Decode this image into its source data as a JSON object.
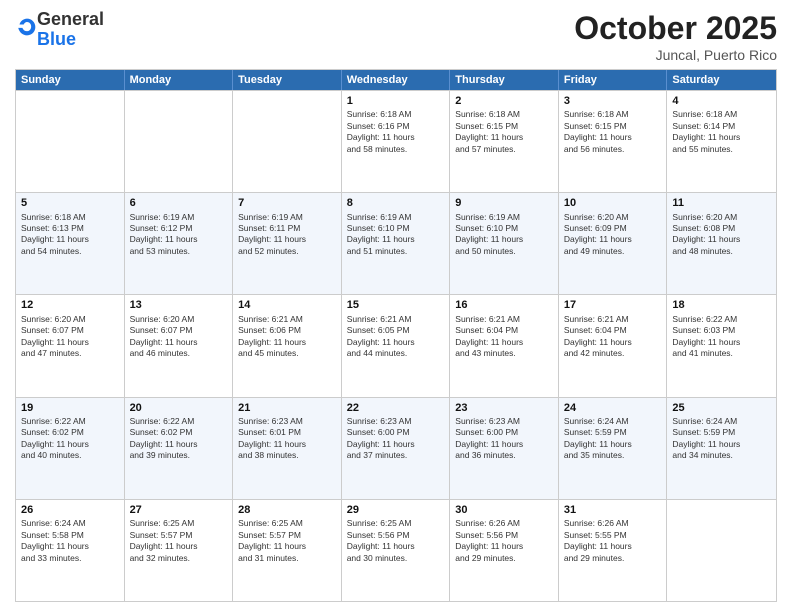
{
  "logo": {
    "general": "General",
    "blue": "Blue"
  },
  "title": {
    "month": "October 2025",
    "location": "Juncal, Puerto Rico"
  },
  "header_days": [
    "Sunday",
    "Monday",
    "Tuesday",
    "Wednesday",
    "Thursday",
    "Friday",
    "Saturday"
  ],
  "rows": [
    {
      "alt": false,
      "cells": [
        {
          "day": "",
          "info": ""
        },
        {
          "day": "",
          "info": ""
        },
        {
          "day": "",
          "info": ""
        },
        {
          "day": "1",
          "info": "Sunrise: 6:18 AM\nSunset: 6:16 PM\nDaylight: 11 hours\nand 58 minutes."
        },
        {
          "day": "2",
          "info": "Sunrise: 6:18 AM\nSunset: 6:15 PM\nDaylight: 11 hours\nand 57 minutes."
        },
        {
          "day": "3",
          "info": "Sunrise: 6:18 AM\nSunset: 6:15 PM\nDaylight: 11 hours\nand 56 minutes."
        },
        {
          "day": "4",
          "info": "Sunrise: 6:18 AM\nSunset: 6:14 PM\nDaylight: 11 hours\nand 55 minutes."
        }
      ]
    },
    {
      "alt": true,
      "cells": [
        {
          "day": "5",
          "info": "Sunrise: 6:18 AM\nSunset: 6:13 PM\nDaylight: 11 hours\nand 54 minutes."
        },
        {
          "day": "6",
          "info": "Sunrise: 6:19 AM\nSunset: 6:12 PM\nDaylight: 11 hours\nand 53 minutes."
        },
        {
          "day": "7",
          "info": "Sunrise: 6:19 AM\nSunset: 6:11 PM\nDaylight: 11 hours\nand 52 minutes."
        },
        {
          "day": "8",
          "info": "Sunrise: 6:19 AM\nSunset: 6:10 PM\nDaylight: 11 hours\nand 51 minutes."
        },
        {
          "day": "9",
          "info": "Sunrise: 6:19 AM\nSunset: 6:10 PM\nDaylight: 11 hours\nand 50 minutes."
        },
        {
          "day": "10",
          "info": "Sunrise: 6:20 AM\nSunset: 6:09 PM\nDaylight: 11 hours\nand 49 minutes."
        },
        {
          "day": "11",
          "info": "Sunrise: 6:20 AM\nSunset: 6:08 PM\nDaylight: 11 hours\nand 48 minutes."
        }
      ]
    },
    {
      "alt": false,
      "cells": [
        {
          "day": "12",
          "info": "Sunrise: 6:20 AM\nSunset: 6:07 PM\nDaylight: 11 hours\nand 47 minutes."
        },
        {
          "day": "13",
          "info": "Sunrise: 6:20 AM\nSunset: 6:07 PM\nDaylight: 11 hours\nand 46 minutes."
        },
        {
          "day": "14",
          "info": "Sunrise: 6:21 AM\nSunset: 6:06 PM\nDaylight: 11 hours\nand 45 minutes."
        },
        {
          "day": "15",
          "info": "Sunrise: 6:21 AM\nSunset: 6:05 PM\nDaylight: 11 hours\nand 44 minutes."
        },
        {
          "day": "16",
          "info": "Sunrise: 6:21 AM\nSunset: 6:04 PM\nDaylight: 11 hours\nand 43 minutes."
        },
        {
          "day": "17",
          "info": "Sunrise: 6:21 AM\nSunset: 6:04 PM\nDaylight: 11 hours\nand 42 minutes."
        },
        {
          "day": "18",
          "info": "Sunrise: 6:22 AM\nSunset: 6:03 PM\nDaylight: 11 hours\nand 41 minutes."
        }
      ]
    },
    {
      "alt": true,
      "cells": [
        {
          "day": "19",
          "info": "Sunrise: 6:22 AM\nSunset: 6:02 PM\nDaylight: 11 hours\nand 40 minutes."
        },
        {
          "day": "20",
          "info": "Sunrise: 6:22 AM\nSunset: 6:02 PM\nDaylight: 11 hours\nand 39 minutes."
        },
        {
          "day": "21",
          "info": "Sunrise: 6:23 AM\nSunset: 6:01 PM\nDaylight: 11 hours\nand 38 minutes."
        },
        {
          "day": "22",
          "info": "Sunrise: 6:23 AM\nSunset: 6:00 PM\nDaylight: 11 hours\nand 37 minutes."
        },
        {
          "day": "23",
          "info": "Sunrise: 6:23 AM\nSunset: 6:00 PM\nDaylight: 11 hours\nand 36 minutes."
        },
        {
          "day": "24",
          "info": "Sunrise: 6:24 AM\nSunset: 5:59 PM\nDaylight: 11 hours\nand 35 minutes."
        },
        {
          "day": "25",
          "info": "Sunrise: 6:24 AM\nSunset: 5:59 PM\nDaylight: 11 hours\nand 34 minutes."
        }
      ]
    },
    {
      "alt": false,
      "cells": [
        {
          "day": "26",
          "info": "Sunrise: 6:24 AM\nSunset: 5:58 PM\nDaylight: 11 hours\nand 33 minutes."
        },
        {
          "day": "27",
          "info": "Sunrise: 6:25 AM\nSunset: 5:57 PM\nDaylight: 11 hours\nand 32 minutes."
        },
        {
          "day": "28",
          "info": "Sunrise: 6:25 AM\nSunset: 5:57 PM\nDaylight: 11 hours\nand 31 minutes."
        },
        {
          "day": "29",
          "info": "Sunrise: 6:25 AM\nSunset: 5:56 PM\nDaylight: 11 hours\nand 30 minutes."
        },
        {
          "day": "30",
          "info": "Sunrise: 6:26 AM\nSunset: 5:56 PM\nDaylight: 11 hours\nand 29 minutes."
        },
        {
          "day": "31",
          "info": "Sunrise: 6:26 AM\nSunset: 5:55 PM\nDaylight: 11 hours\nand 29 minutes."
        },
        {
          "day": "",
          "info": ""
        }
      ]
    }
  ]
}
